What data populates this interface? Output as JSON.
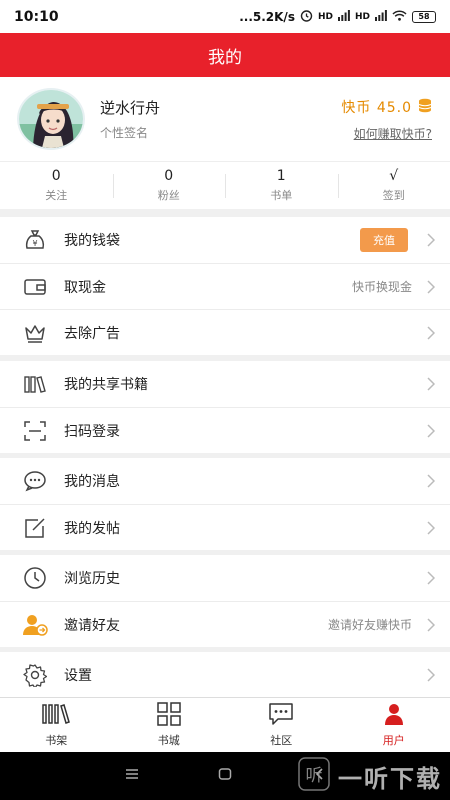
{
  "status_bar": {
    "time": "10:10",
    "speed": "...5.2K/s",
    "signal1": "HD",
    "signal2": "HD",
    "battery": "58"
  },
  "header": {
    "title": "我的"
  },
  "profile": {
    "name": "逆水行舟",
    "signature": "个性签名",
    "coin_label": "快币 45.0",
    "coin_link": "如何赚取快币?"
  },
  "stats": [
    {
      "value": "0",
      "label": "关注"
    },
    {
      "value": "0",
      "label": "粉丝"
    },
    {
      "value": "1",
      "label": "书单"
    },
    {
      "value": "√",
      "label": "签到"
    }
  ],
  "menu": {
    "wallet": {
      "label": "我的钱袋",
      "badge": "充值"
    },
    "withdraw": {
      "label": "取现金",
      "extra": "快币换现金"
    },
    "remove_ads": {
      "label": "去除广告"
    },
    "shared_books": {
      "label": "我的共享书籍"
    },
    "scan_login": {
      "label": "扫码登录"
    },
    "messages": {
      "label": "我的消息"
    },
    "posts": {
      "label": "我的发帖"
    },
    "history": {
      "label": "浏览历史"
    },
    "invite": {
      "label": "邀请好友",
      "extra": "邀请好友赚快币"
    },
    "settings": {
      "label": "设置"
    }
  },
  "tabs": [
    {
      "label": "书架",
      "icon": "bookshelf-icon"
    },
    {
      "label": "书城",
      "icon": "grid-icon"
    },
    {
      "label": "社区",
      "icon": "chat-icon"
    },
    {
      "label": "用户",
      "icon": "user-icon"
    }
  ],
  "watermark": {
    "text": "一听下载",
    "logo_text": "听"
  },
  "colors": {
    "accent": "#e8212b",
    "coin": "#e58a00",
    "recharge": "#f39a4b",
    "active_tab": "#d61f1f"
  }
}
